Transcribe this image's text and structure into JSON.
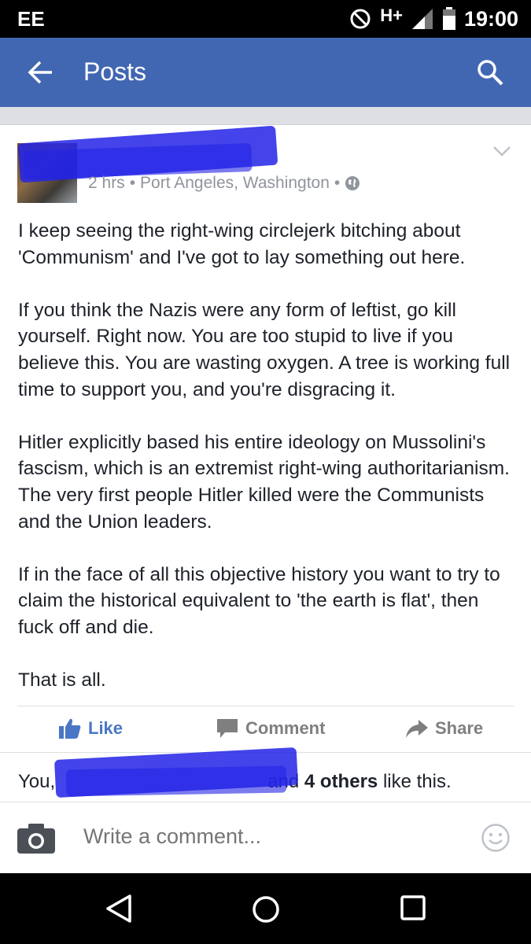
{
  "status_bar": {
    "carrier": "EE",
    "network": "H+",
    "time": "19:00",
    "icons": [
      "no-disturb-icon",
      "signal-icon",
      "battery-icon"
    ]
  },
  "app_bar": {
    "title": "Posts",
    "icons": [
      "back-arrow-icon",
      "search-icon"
    ],
    "color": "#4267b2"
  },
  "post": {
    "author": "",
    "time": "2 hrs",
    "location": "Port Angeles, Washington",
    "separator": "•",
    "privacy_icon": "globe-icon",
    "paragraphs": [
      "I keep seeing the right-wing circlejerk bitching about 'Communism' and I've got to lay something out here.",
      "If you think the Nazis were any form of leftist, go kill yourself. Right now. You are too stupid to live if you believe this. You are wasting oxygen. A tree is working full time to support you, and you're disgracing it.",
      "Hitler explicitly based his entire ideology on Mussolini's fascism, which is an extremist right-wing authoritarianism. The very first people Hitler killed were the Communists and the Union leaders.",
      "If in the face of all this objective history you want to try to claim the historical equivalent to 'the earth is flat', then fuck off and die.",
      "That is all."
    ]
  },
  "actions": {
    "like": "Like",
    "comment": "Comment",
    "share": "Share",
    "like_color": "#4a76c6"
  },
  "likes": {
    "prefix": "You,",
    "suffix_before": "and",
    "others": "4 others",
    "suffix_after": "like this."
  },
  "comment_bar": {
    "placeholder": "Write a comment..."
  },
  "nav_bar": {
    "icons": [
      "nav-back-icon",
      "nav-home-icon",
      "nav-recent-apps-icon"
    ]
  }
}
